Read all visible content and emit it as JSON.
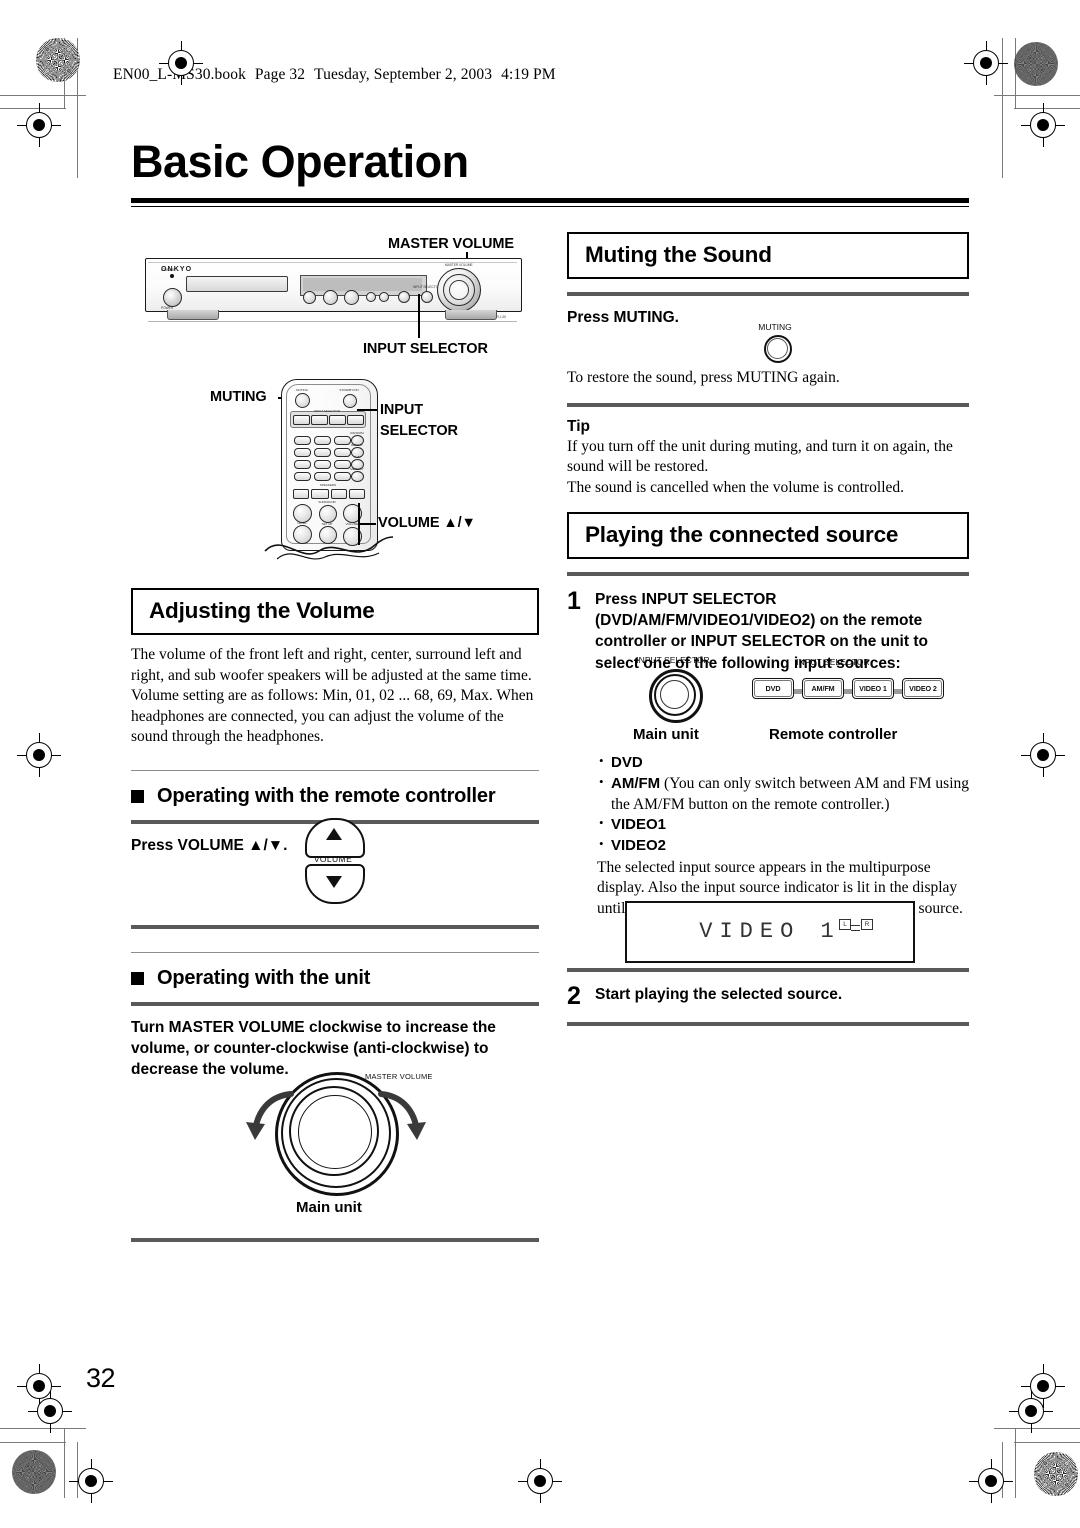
{
  "header": {
    "file_line": "EN00_L-MS30.book  Page 32  Tuesday, September 2, 2003  4:19 PM",
    "file_name": "EN00_L-MS30.book",
    "page_label": "Page 32",
    "weekday_date": "Tuesday, September 2, 2003",
    "time": "4:19 PM"
  },
  "page": {
    "title": "Basic Operation",
    "number": "32"
  },
  "figures": {
    "main_unit_callouts": {
      "master_volume": "MASTER VOLUME",
      "input_selector": "INPUT SELECTOR"
    },
    "receiver": {
      "brand": "ONKYO",
      "model": "DVD RECEIVER  DR-L30",
      "standby_label": "STANDBY",
      "power_label": "POWER",
      "knob_label": "MASTER VOLUME",
      "input_selector_label": "INPUT SELECTOR"
    },
    "remote_callouts": {
      "muting": "MUTING",
      "input_selector_line1": "INPUT",
      "input_selector_line2": "SELECTOR",
      "volume": "VOLUME ▲/▼"
    },
    "remote_labels": {
      "muting": "MUTING",
      "standby": "STANDBY/ON",
      "input_selector": "INPUT SELECTOR",
      "speakers": "SPEAKERS",
      "random": "RANDOM",
      "repeat": "REPEAT",
      "ab": "A-B",
      "memory": "MEMORY",
      "menu": "MENU",
      "clear": "CLEAR",
      "top": "TOP",
      "enter": "ENTER",
      "retn": "RETURN",
      "disp": "DISPLAY",
      "level": "LEVEL",
      "surround": "SURROUND",
      "display": "DISPLAY",
      "setup": "SET UP",
      "volume": "VOLUME",
      "keys": [
        "DVD",
        "AM/FM",
        "VIDEO1",
        "VIDEO2"
      ]
    },
    "volume_button": {
      "label": "VOLUME",
      "up_glyph": "▲",
      "down_glyph": "▼"
    },
    "master_volume_knob": {
      "label": "MASTER VOLUME",
      "caption": "Main unit"
    },
    "muting_button": {
      "label": "MUTING"
    },
    "input_selector_knob": {
      "label": "INPUT SELECTOR",
      "caption": "Main unit"
    },
    "input_selector_remote": {
      "label": "INPUT SELECTOR",
      "caption": "Remote controller",
      "keys": [
        "DVD",
        "AM/FM",
        "VIDEO 1",
        "VIDEO 2"
      ]
    },
    "lcd_display": {
      "text": "VIDEO 1",
      "indicator_left": "L",
      "indicator_right": "R"
    }
  },
  "sections": {
    "adjusting_volume": {
      "heading": "Adjusting the Volume",
      "body": "The volume of the front left and right, center, surround left and right, and sub woofer speakers will be adjusted at the same time. Volume setting are as follows: Min, 01, 02 ... 68, 69, Max. When headphones are connected, you can adjust the volume of the sound through the headphones.",
      "sub_remote": "Operating with the remote controller",
      "press_volume": "Press VOLUME ▲/▼.",
      "sub_unit": "Operating with the unit",
      "unit_instruction": "Turn MASTER VOLUME clockwise to increase the volume, or counter-clockwise (anti-clockwise) to decrease the volume."
    },
    "muting_the_sound": {
      "heading": "Muting the Sound",
      "press": "Press MUTING.",
      "restore": "To restore the sound, press MUTING again.",
      "tip_head": "Tip",
      "tip_body_1": "If you turn off the unit during muting, and turn it on again, the sound will be restored.",
      "tip_body_2": "The sound is cancelled when the volume is controlled."
    },
    "playing_connected_source": {
      "heading": "Playing the connected source",
      "step1_num": "1",
      "step1_text": "Press INPUT SELECTOR (DVD/AM/FM/VIDEO1/VIDEO2) on the remote controller or INPUT SELECTOR on the unit to select one of the following input sources:",
      "bullets": [
        {
          "bold": "DVD",
          "rest": ""
        },
        {
          "bold": "AM/FM",
          "rest": " (You can only switch between AM and FM using the AM/FM button on the remote controller.)"
        },
        {
          "bold": "VIDEO1",
          "rest": ""
        },
        {
          "bold": "VIDEO2",
          "rest": ""
        }
      ],
      "after_bullets": "The selected input source appears in the multipurpose display. Also the input source indicator is lit in the display until the DVD receiver is switched to another input source.",
      "step2_num": "2",
      "step2_text": "Start playing the selected source."
    }
  }
}
